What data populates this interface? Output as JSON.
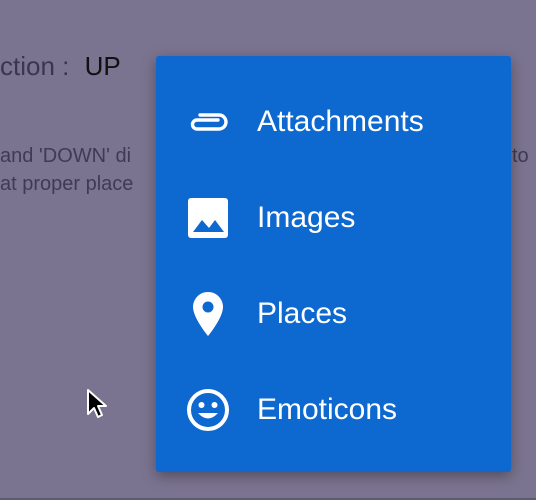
{
  "background": {
    "direction_label": "ction :",
    "direction_value": "UP",
    "description_line1_left": "and 'DOWN' di",
    "description_line1_right": "to",
    "description_line2_left": "at proper place"
  },
  "menu": {
    "color": "#0d68d0",
    "items": [
      {
        "label": "Attachments",
        "icon": "attachment-icon"
      },
      {
        "label": "Images",
        "icon": "image-icon"
      },
      {
        "label": "Places",
        "icon": "place-icon"
      },
      {
        "label": "Emoticons",
        "icon": "emoticon-icon"
      }
    ]
  },
  "colors": {
    "scrim": "#7b7490",
    "menu_background": "#0d68d0",
    "menu_text": "#ffffff"
  }
}
